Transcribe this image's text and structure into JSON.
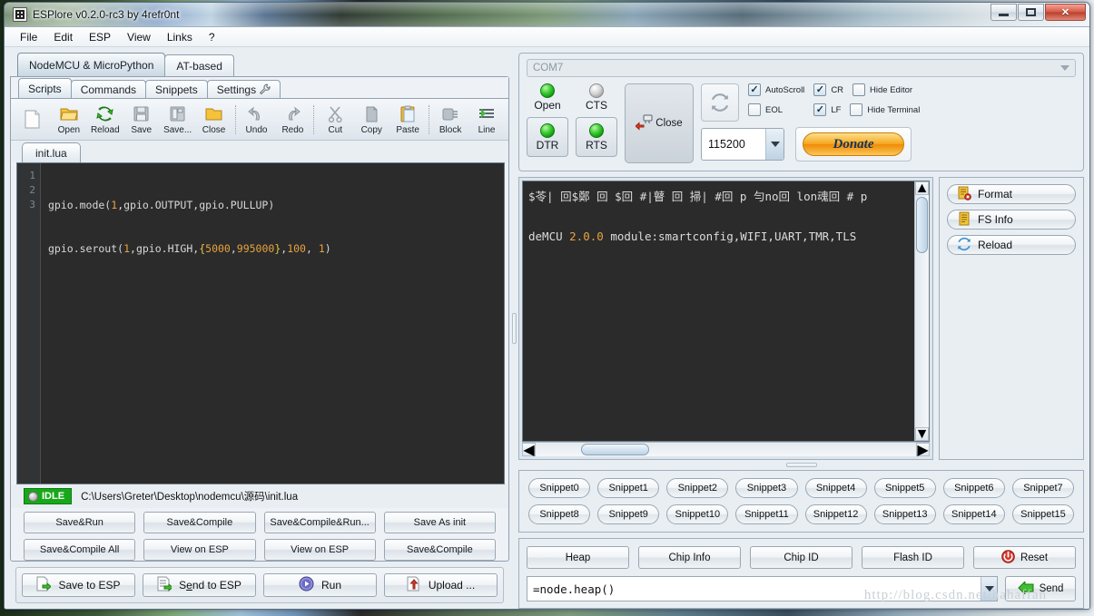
{
  "window": {
    "title": "ESPlore v0.2.0-rc3 by 4refr0nt",
    "app_icon": "chip-icon",
    "minimize": "minimize-icon",
    "maximize": "maximize-icon",
    "close": "close-icon"
  },
  "menubar": {
    "items": [
      "File",
      "Edit",
      "ESP",
      "View",
      "Links",
      "?"
    ]
  },
  "outer_tabs": [
    {
      "label": "NodeMCU & MicroPython",
      "active": true
    },
    {
      "label": "AT-based",
      "active": false
    }
  ],
  "inner_tabs": [
    {
      "label": "Scripts",
      "active": true,
      "icon": ""
    },
    {
      "label": "Commands",
      "active": false,
      "icon": ""
    },
    {
      "label": "Snippets",
      "active": false,
      "icon": ""
    },
    {
      "label": "Settings",
      "active": false,
      "icon": "wrench-icon"
    }
  ],
  "toolbar": [
    {
      "label": "",
      "icon": "new-file-icon"
    },
    {
      "label": "Open",
      "icon": "open-folder-icon"
    },
    {
      "label": "Reload",
      "icon": "reload-icon"
    },
    {
      "label": "Save",
      "icon": "save-disk-icon"
    },
    {
      "label": "Save...",
      "icon": "save-as-icon"
    },
    {
      "label": "Close",
      "icon": "close-folder-icon"
    },
    {
      "label": "Undo",
      "icon": "undo-icon"
    },
    {
      "label": "Redo",
      "icon": "redo-icon"
    },
    {
      "label": "Cut",
      "icon": "scissors-icon"
    },
    {
      "label": "Copy",
      "icon": "copy-icon"
    },
    {
      "label": "Paste",
      "icon": "paste-icon"
    },
    {
      "label": "Block",
      "icon": "block-icon"
    },
    {
      "label": "Line",
      "icon": "line-icon"
    }
  ],
  "file_tabs": [
    {
      "label": "init.lua",
      "active": true
    }
  ],
  "editor": {
    "line_numbers": [
      "1",
      "2",
      "3"
    ],
    "lines": [
      "gpio.mode(1,gpio.OUTPUT,gpio.PULLUP)",
      "gpio.serout(1,gpio.HIGH,{5000,995000},100, 1)",
      ""
    ]
  },
  "status": {
    "badge": "IDLE",
    "badge_color": "#17a81a",
    "path": "C:\\Users\\Greter\\Desktop\\nodemcu\\源码\\init.lua"
  },
  "action_buttons": [
    "Save&Run",
    "Save&Compile",
    "Save&Compile&Run...",
    "Save As init",
    "Save&Compile All",
    "View on ESP",
    "View on ESP",
    "Save&Compile"
  ],
  "bottom_buttons": [
    {
      "label": "Save to ESP",
      "icon": "save-to-esp-icon"
    },
    {
      "label": "Send to ESP",
      "icon": "send-to-esp-icon",
      "mnemonic": "e"
    },
    {
      "label": "Run",
      "icon": "run-icon"
    },
    {
      "label": "Upload ...",
      "icon": "upload-icon"
    }
  ],
  "connection": {
    "com_port": "COM7",
    "leds": [
      {
        "label": "Open",
        "state": "on"
      },
      {
        "label": "CTS",
        "state": "off"
      }
    ],
    "toggles": [
      {
        "label": "DTR",
        "state": "on"
      },
      {
        "label": "RTS",
        "state": "on"
      }
    ],
    "close_button": {
      "label": "Close",
      "icon": "disconnect-icon"
    },
    "refresh_icon": "refresh-icon",
    "checkboxes": [
      {
        "label": "AutoScroll",
        "checked": true
      },
      {
        "label": "EOL",
        "checked": false
      },
      {
        "label": "CR",
        "checked": true
      },
      {
        "label": "LF",
        "checked": true
      },
      {
        "label": "Hide Editor",
        "checked": false
      },
      {
        "label": "Hide Terminal",
        "checked": false
      }
    ],
    "baud_rate": "115200",
    "donate_label": "Donate"
  },
  "terminal": {
    "line1": "$苓| 回$鄭   回 $回 #|瞽 回 掃| #回 p 勻no回 lon魂回 # p",
    "line2_pre": "deMCU ",
    "line2_ver": "2.0.0",
    "line2_post": " module:smartconfig,WIFI,UART,TMR,TLS"
  },
  "fs_buttons": [
    {
      "label": "Format",
      "icon": "format-icon"
    },
    {
      "label": "FS Info",
      "icon": "fs-info-icon"
    },
    {
      "label": "Reload",
      "icon": "reload-icon"
    }
  ],
  "snippets": {
    "row1": [
      "Snippet0",
      "Snippet1",
      "Snippet2",
      "Snippet3",
      "Snippet4",
      "Snippet5",
      "Snippet6",
      "Snippet7"
    ],
    "row2": [
      "Snippet8",
      "Snippet9",
      "Snippet10",
      "Snippet11",
      "Snippet12",
      "Snippet13",
      "Snippet14",
      "Snippet15"
    ]
  },
  "commands": {
    "buttons": [
      {
        "label": "Heap",
        "icon": ""
      },
      {
        "label": "Chip Info",
        "icon": ""
      },
      {
        "label": "Chip ID",
        "icon": ""
      },
      {
        "label": "Flash ID",
        "icon": ""
      },
      {
        "label": "Reset",
        "icon": "power-icon"
      }
    ],
    "input_value": "=node.heap()",
    "send_label": "Send",
    "send_icon": "send-arrow-icon"
  },
  "watermark": "http://blog.csdn.net/hahaffan"
}
